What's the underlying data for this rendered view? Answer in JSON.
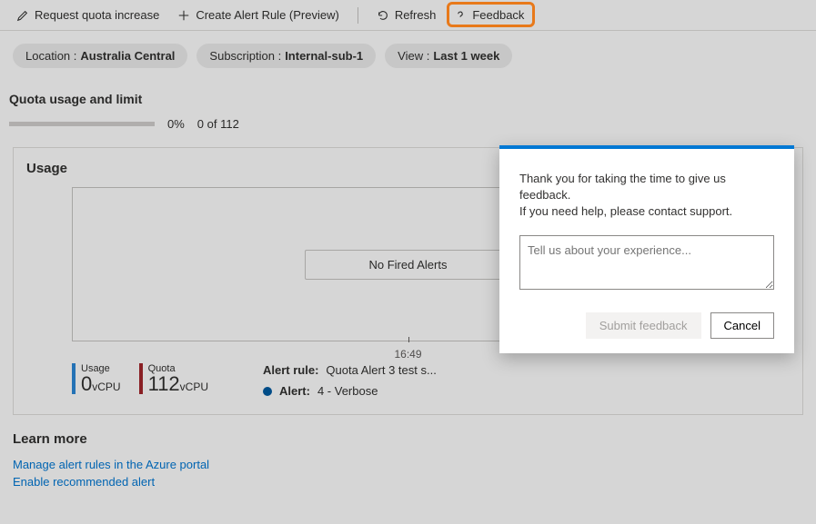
{
  "toolbar": {
    "request_quota": "Request quota increase",
    "create_alert": "Create Alert Rule (Preview)",
    "refresh": "Refresh",
    "feedback": "Feedback"
  },
  "filters": {
    "location": {
      "label": "Location :",
      "value": "Australia Central"
    },
    "subscription": {
      "label": "Subscription :",
      "value": "Internal-sub-1"
    },
    "view": {
      "label": "View :",
      "value": "Last 1 week"
    }
  },
  "section_title": "Quota usage and limit",
  "progress": {
    "percent": "0%",
    "fraction": "0 of 112"
  },
  "card": {
    "title": "Usage",
    "no_alerts": "No Fired Alerts",
    "tick_label": "16:49",
    "usage_stat": {
      "label": "Usage",
      "value": "0",
      "unit": "vCPU"
    },
    "quota_stat": {
      "label": "Quota",
      "value": "112",
      "unit": "vCPU"
    },
    "alert_rule_label": "Alert rule:",
    "alert_rule_value": "Quota Alert 3 test s...",
    "alert_label": "Alert:",
    "alert_value": "4 - Verbose"
  },
  "learn": {
    "title": "Learn more",
    "link1": "Manage alert rules in the Azure portal",
    "link2": "Enable recommended alert"
  },
  "popup": {
    "line1": "Thank you for taking the time to give us feedback.",
    "line2": "If you need help, please contact support.",
    "placeholder": "Tell us about your experience...",
    "submit": "Submit feedback",
    "cancel": "Cancel"
  }
}
